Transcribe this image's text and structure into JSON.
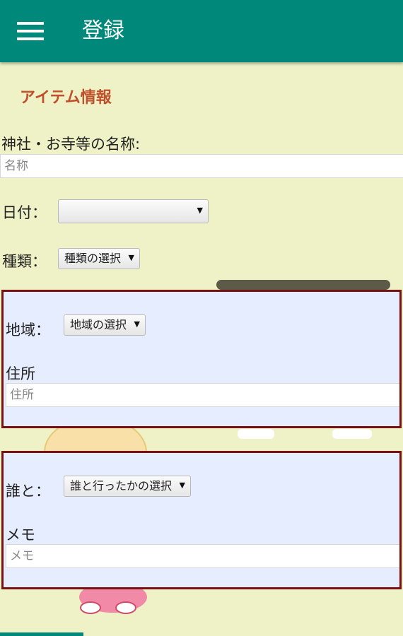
{
  "appbar": {
    "title": "登録",
    "menu_icon": "hamburger-menu-icon"
  },
  "section_title": "アイテム情報",
  "shrine_name": {
    "label": "神社・お寺等の名称:",
    "placeholder": "名称",
    "value": ""
  },
  "date": {
    "label": "日付：",
    "value": ""
  },
  "category": {
    "label": "種類：",
    "value": "種類の選択"
  },
  "region_panel": {
    "region": {
      "label": "地域：",
      "value": "地域の選択"
    },
    "address": {
      "label": "住所",
      "placeholder": "住所",
      "value": ""
    }
  },
  "companion_panel": {
    "companion": {
      "label": "誰と：",
      "value": "誰と行ったかの選択"
    },
    "memo": {
      "label": "メモ",
      "placeholder": "メモ",
      "value": ""
    }
  },
  "colors": {
    "appbar": "#00897b",
    "background": "#eef2c6",
    "accent_title": "#c0502c",
    "panel_border": "#7a1010",
    "panel_fill": "#e6edff"
  },
  "dropdown_arrow": "▼"
}
